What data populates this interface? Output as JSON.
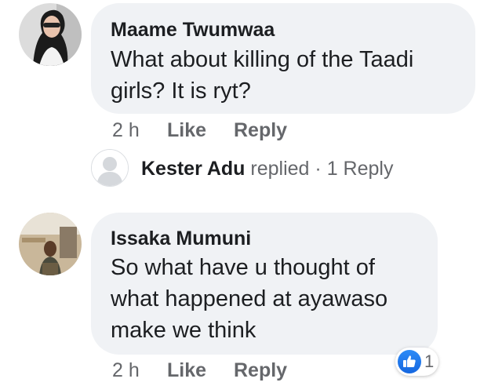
{
  "comments": [
    {
      "author": "Maame Twumwaa",
      "text_lines": [
        "What about killing of the Taadi",
        "girls? It is ryt?"
      ],
      "time": "2 h",
      "like_label": "Like",
      "reply_label": "Reply",
      "replies_summary": {
        "author": "Kester Adu",
        "verb": "replied",
        "separator": "·",
        "count_label": "1 Reply"
      }
    },
    {
      "author": "Issaka Mumuni",
      "text_lines": [
        "So what have u thought of",
        "what happened at ayawaso",
        "make we think"
      ],
      "time": "2 h",
      "like_label": "Like",
      "reply_label": "Reply",
      "reactions": {
        "icon": "thumbs-up-icon",
        "count": "1"
      }
    }
  ],
  "colors": {
    "bubble_bg": "#f0f2f5",
    "meta_text": "#65676b",
    "like_blue": "#1877f2"
  }
}
